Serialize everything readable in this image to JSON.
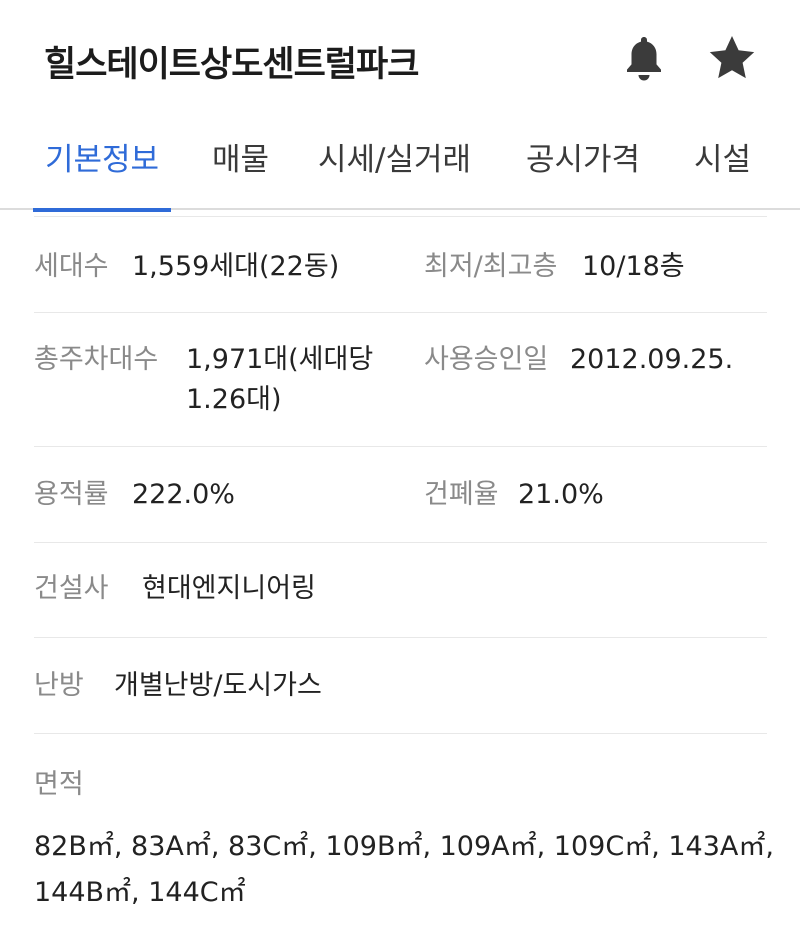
{
  "header": {
    "title": "힐스테이트상도센트럴파크",
    "icons": {
      "bell": "bell-icon",
      "star": "star-icon"
    }
  },
  "tabs": [
    {
      "label": "기본정보",
      "active": true
    },
    {
      "label": "매물"
    },
    {
      "label": "시세/실거래"
    },
    {
      "label": "공시가격"
    },
    {
      "label": "시설"
    }
  ],
  "colors": {
    "accent": "#2f6bd8",
    "label": "#8a8a8a",
    "text": "#222222"
  },
  "info": {
    "households": {
      "label": "세대수",
      "value": "1,559세대(22동)"
    },
    "floors": {
      "label": "최저/최고층",
      "value": "10/18층"
    },
    "parking": {
      "label": "총주차대수",
      "value": "1,971대(세대당 1.26대)"
    },
    "approval": {
      "label": "사용승인일",
      "value": "2012.09.25."
    },
    "far": {
      "label": "용적률",
      "value": "222.0%"
    },
    "bcr": {
      "label": "건폐율",
      "value": "21.0%"
    },
    "builder": {
      "label": "건설사",
      "value": "현대엔지니어링"
    },
    "heating": {
      "label": "난방",
      "value": "개별난방/도시가스"
    }
  },
  "area": {
    "label": "면적",
    "value": "82B㎡, 83A㎡, 83C㎡, 109B㎡, 109A㎡, 109C㎡, 143A㎡, 144B㎡, 144C㎡"
  }
}
